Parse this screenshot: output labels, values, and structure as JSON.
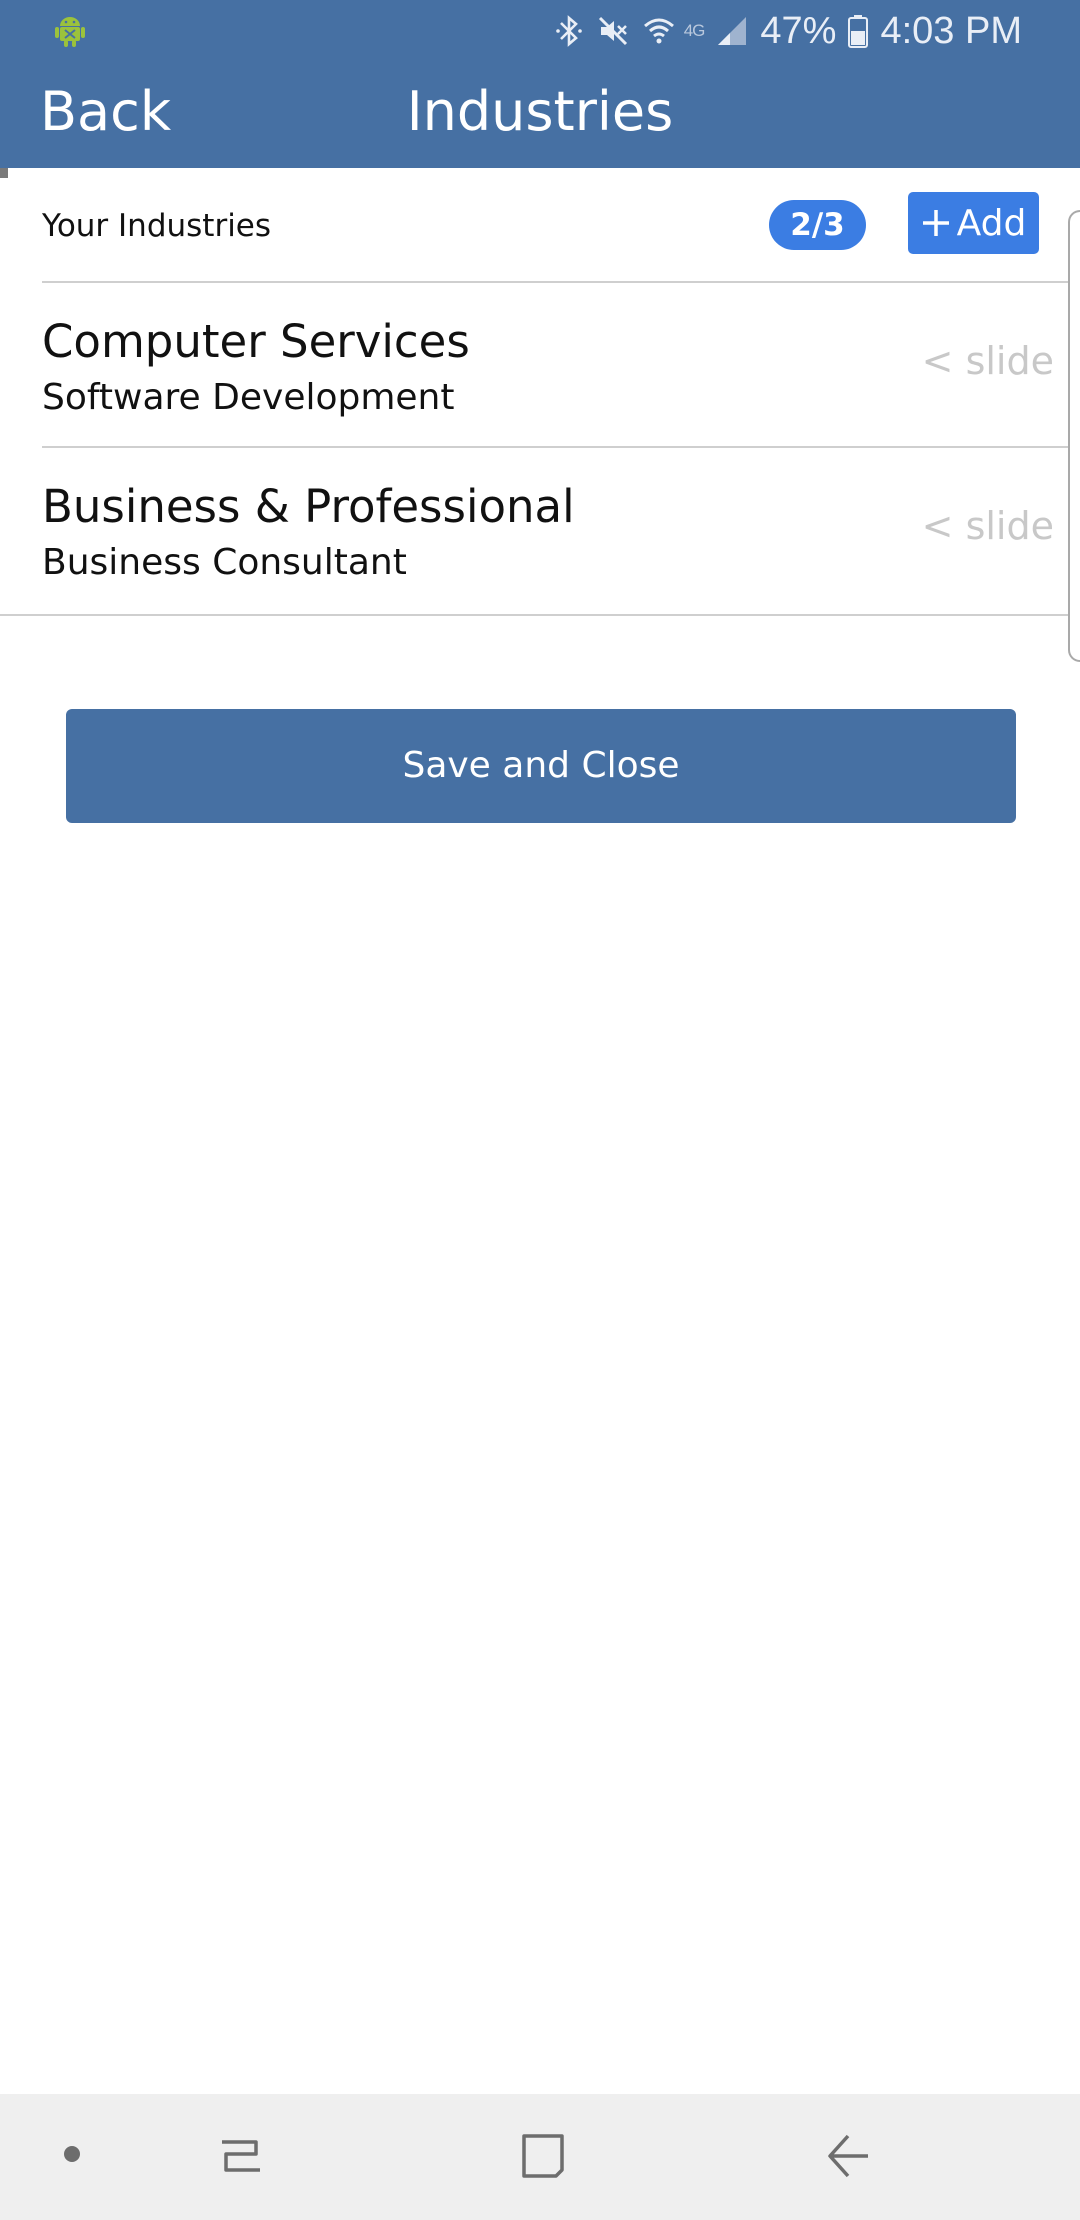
{
  "status_bar": {
    "battery_percent": "47%",
    "time": "4:03 PM",
    "network": "4G",
    "icons": [
      "android-debug-icon",
      "bluetooth-icon",
      "mute-icon",
      "wifi-icon",
      "lte-icon",
      "signal-icon",
      "battery-icon"
    ]
  },
  "header": {
    "back_label": "Back",
    "title": "Industries"
  },
  "section": {
    "title": "Your Industries",
    "count_badge": "2/3",
    "add_label": "Add"
  },
  "industries": [
    {
      "title": "Computer Services",
      "subtitle": "Software Development",
      "slide_hint": "< slide"
    },
    {
      "title": "Business & Professional",
      "subtitle": "Business Consultant",
      "slide_hint": "< slide"
    }
  ],
  "save_label": "Save and Close",
  "nav_bar": {
    "icons": [
      "nav-dot-icon",
      "recent-apps-icon",
      "home-icon",
      "back-icon"
    ]
  },
  "colors": {
    "header_bg": "#4670a3",
    "accent": "#3b7de3",
    "slide_hint": "#c8c8c8",
    "nav_bg": "#efefef"
  }
}
